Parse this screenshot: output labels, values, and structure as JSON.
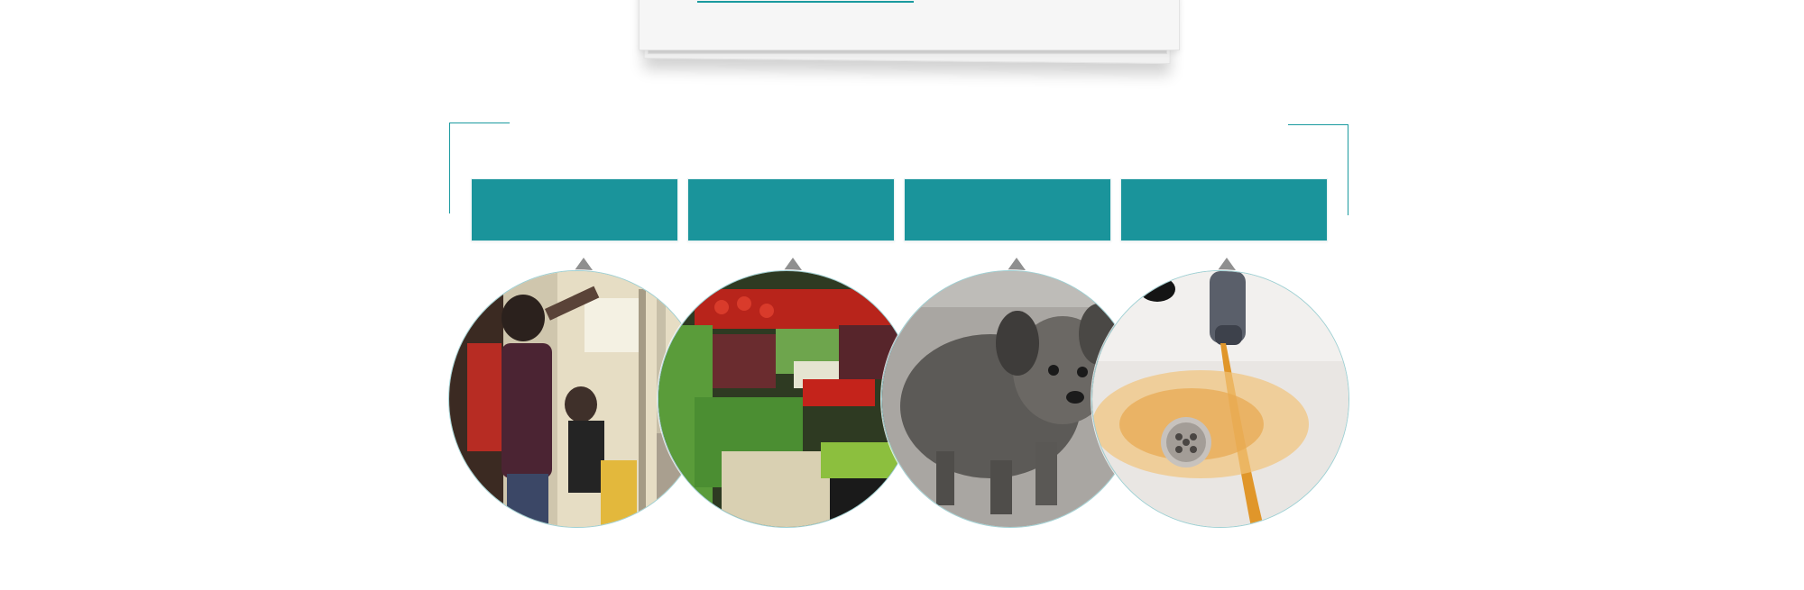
{
  "colors": {
    "accent": "#1a949b",
    "border": "#9fd0d3"
  },
  "tiles": [
    {
      "name": "tile-1"
    },
    {
      "name": "tile-2"
    },
    {
      "name": "tile-3"
    },
    {
      "name": "tile-4"
    }
  ],
  "images": [
    {
      "subject": "crowded-subway-photo"
    },
    {
      "subject": "vegetable-market-photo"
    },
    {
      "subject": "dirty-stray-dog-photo"
    },
    {
      "subject": "rusty-water-sink-photo"
    }
  ]
}
